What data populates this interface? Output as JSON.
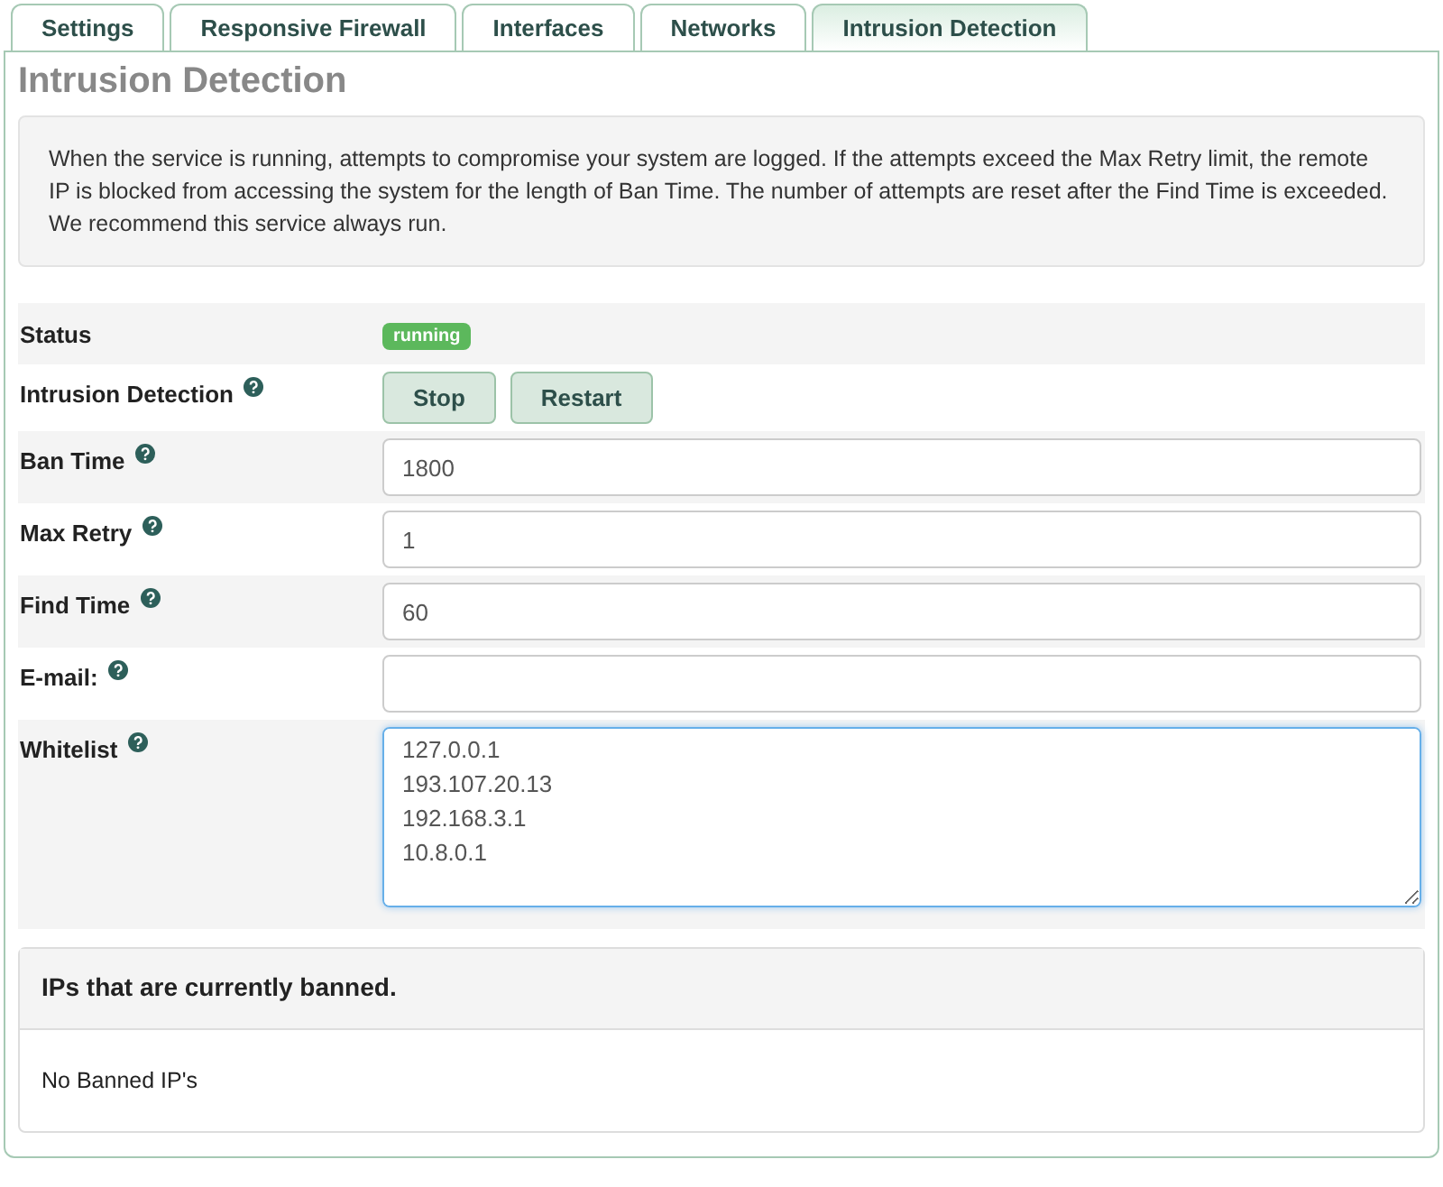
{
  "tabs": [
    {
      "label": "Settings",
      "selected": false
    },
    {
      "label": "Responsive Firewall",
      "selected": false
    },
    {
      "label": "Interfaces",
      "selected": false
    },
    {
      "label": "Networks",
      "selected": false
    },
    {
      "label": "Intrusion Detection",
      "selected": true
    }
  ],
  "title": "Intrusion Detection",
  "info": [
    "When the service is running, attempts to compromise your system are logged. If the attempts exceed the Max Retry limit, the remote IP is blocked from accessing the system for the length of Ban Time. The number of attempts are reset after the Find Time is exceeded.",
    "We recommend this service always run."
  ],
  "rows": [
    {
      "kind": "status",
      "label": "Status",
      "help": false,
      "badge": "running"
    },
    {
      "kind": "buttons",
      "label": "Intrusion Detection",
      "help": true,
      "buttons": [
        "Stop",
        "Restart"
      ]
    },
    {
      "kind": "input",
      "label": "Ban Time",
      "help": true,
      "value": "1800"
    },
    {
      "kind": "input",
      "label": "Max Retry",
      "help": true,
      "value": "1"
    },
    {
      "kind": "input",
      "label": "Find Time",
      "help": true,
      "value": "60"
    },
    {
      "kind": "input",
      "label": "E-mail:",
      "help": true
    },
    {
      "kind": "textarea",
      "label": "Whitelist",
      "help": true,
      "value": "127.0.0.1\n193.107.20.13\n192.168.3.1\n10.8.0.1\n"
    }
  ],
  "banned": {
    "title": "IPs that are currently banned.",
    "body": "No Banned IP's"
  }
}
